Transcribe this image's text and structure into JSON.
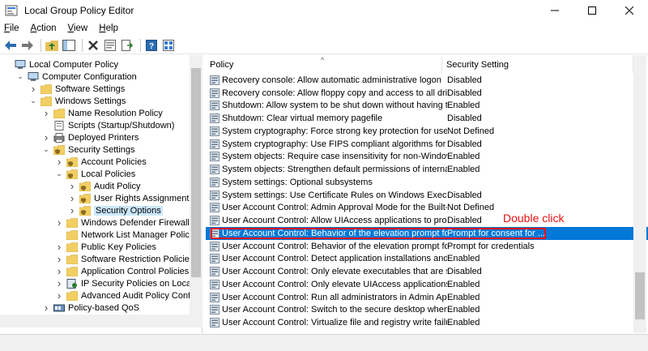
{
  "window": {
    "title": "Local Group Policy Editor"
  },
  "menu": [
    {
      "key": "F",
      "rest": "ile"
    },
    {
      "key": "A",
      "rest": "ction"
    },
    {
      "key": "V",
      "rest": "iew"
    },
    {
      "key": "H",
      "rest": "elp"
    }
  ],
  "tree": [
    {
      "label": "Local Computer Policy",
      "indent": 0,
      "arrow": "",
      "icon": "computer-icon"
    },
    {
      "label": "Computer Configuration",
      "indent": 1,
      "arrow": "down",
      "icon": "computer-icon"
    },
    {
      "label": "Software Settings",
      "indent": 2,
      "arrow": "right",
      "icon": "folder-icon"
    },
    {
      "label": "Windows Settings",
      "indent": 2,
      "arrow": "down",
      "icon": "folder-icon"
    },
    {
      "label": "Name Resolution Policy",
      "indent": 3,
      "arrow": "right",
      "icon": "folder-icon"
    },
    {
      "label": "Scripts (Startup/Shutdown)",
      "indent": 3,
      "arrow": "",
      "icon": "script-icon"
    },
    {
      "label": "Deployed Printers",
      "indent": 3,
      "arrow": "right",
      "icon": "printer-icon"
    },
    {
      "label": "Security Settings",
      "indent": 3,
      "arrow": "down",
      "icon": "security-folder-icon"
    },
    {
      "label": "Account Policies",
      "indent": 4,
      "arrow": "right",
      "icon": "security-folder-icon"
    },
    {
      "label": "Local Policies",
      "indent": 4,
      "arrow": "down",
      "icon": "security-folder-icon"
    },
    {
      "label": "Audit Policy",
      "indent": 5,
      "arrow": "right",
      "icon": "security-folder-icon"
    },
    {
      "label": "User Rights Assignment",
      "indent": 5,
      "arrow": "right",
      "icon": "security-folder-icon"
    },
    {
      "label": "Security Options",
      "indent": 5,
      "arrow": "right",
      "icon": "security-folder-icon",
      "selected": true
    },
    {
      "label": "Windows Defender Firewall with A",
      "indent": 4,
      "arrow": "right",
      "icon": "folder-icon"
    },
    {
      "label": "Network List Manager Policies",
      "indent": 4,
      "arrow": "",
      "icon": "folder-icon"
    },
    {
      "label": "Public Key Policies",
      "indent": 4,
      "arrow": "right",
      "icon": "folder-icon"
    },
    {
      "label": "Software Restriction Policies",
      "indent": 4,
      "arrow": "right",
      "icon": "folder-icon"
    },
    {
      "label": "Application Control Policies",
      "indent": 4,
      "arrow": "right",
      "icon": "folder-icon"
    },
    {
      "label": "IP Security Policies on Local Comp",
      "indent": 4,
      "arrow": "right",
      "icon": "ip-security-icon"
    },
    {
      "label": "Advanced Audit Policy Configurat",
      "indent": 4,
      "arrow": "right",
      "icon": "folder-icon"
    },
    {
      "label": "Policy-based QoS",
      "indent": 3,
      "arrow": "right",
      "icon": "qos-icon"
    },
    {
      "label": "Administrative Templates",
      "indent": 2,
      "arrow": "right",
      "icon": "folder-icon"
    }
  ],
  "list": {
    "columns": [
      "Policy",
      "Security Setting"
    ],
    "rows": [
      {
        "policy": "Recovery console: Allow automatic administrative logon",
        "setting": "Disabled"
      },
      {
        "policy": "Recovery console: Allow floppy copy and access to all drives...",
        "setting": "Disabled"
      },
      {
        "policy": "Shutdown: Allow system to be shut down without having to...",
        "setting": "Enabled"
      },
      {
        "policy": "Shutdown: Clear virtual memory pagefile",
        "setting": "Disabled"
      },
      {
        "policy": "System cryptography: Force strong key protection for user k...",
        "setting": "Not Defined"
      },
      {
        "policy": "System cryptography: Use FIPS compliant algorithms for en...",
        "setting": "Disabled"
      },
      {
        "policy": "System objects: Require case insensitivity for non-Windows ...",
        "setting": "Enabled"
      },
      {
        "policy": "System objects: Strengthen default permissions of internal s...",
        "setting": "Enabled"
      },
      {
        "policy": "System settings: Optional subsystems",
        "setting": ""
      },
      {
        "policy": "System settings: Use Certificate Rules on Windows Executabl...",
        "setting": "Disabled"
      },
      {
        "policy": "User Account Control: Admin Approval Mode for the Built-i...",
        "setting": "Not Defined"
      },
      {
        "policy": "User Account Control: Allow UIAccess applications to prom...",
        "setting": "Disabled"
      },
      {
        "policy": "User Account Control: Behavior of the elevation prompt for ...",
        "setting": "Prompt for consent for ...",
        "selected": true
      },
      {
        "policy": "User Account Control: Behavior of the elevation prompt for ...",
        "setting": "Prompt for credentials"
      },
      {
        "policy": "User Account Control: Detect application installations and p...",
        "setting": "Enabled"
      },
      {
        "policy": "User Account Control: Only elevate executables that are sign...",
        "setting": "Disabled"
      },
      {
        "policy": "User Account Control: Only elevate UIAccess applications th...",
        "setting": "Enabled"
      },
      {
        "policy": "User Account Control: Run all administrators in Admin Appr...",
        "setting": "Enabled"
      },
      {
        "policy": "User Account Control: Switch to the secure desktop when pr...",
        "setting": "Enabled"
      },
      {
        "policy": "User Account Control: Virtualize file and registry write failure...",
        "setting": "Enabled"
      }
    ]
  },
  "annotation": {
    "text": "Double click"
  },
  "colors": {
    "accent": "#0078d7",
    "annotation": "#e11111",
    "tree_selected": "#cce8ff"
  }
}
